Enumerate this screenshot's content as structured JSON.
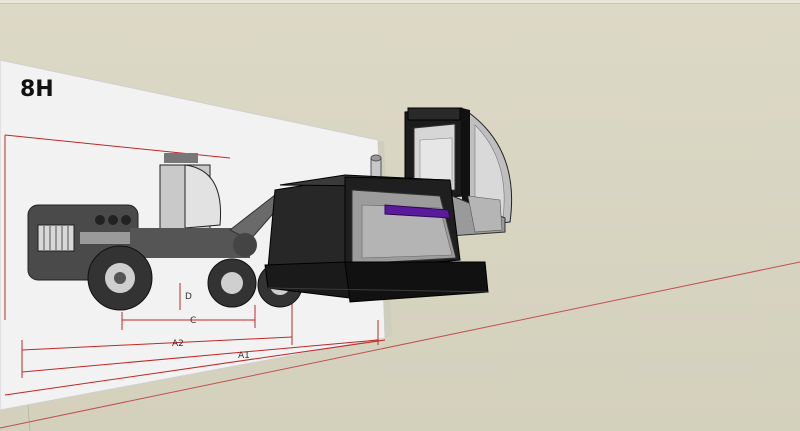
{
  "sheet": {
    "title": "8H",
    "dimension_labels": {
      "d": "D",
      "c": "C",
      "a2": "A2",
      "a1": "A1"
    }
  },
  "colors": {
    "background": "#d8d5c2",
    "sheet": "#f2f2f2",
    "dimension_line": "#c02828",
    "model_body": "#2b2b2b",
    "model_panel": "#9c9c9c",
    "model_stripe": "#5a1a9c",
    "axis_line": "#c05050"
  }
}
